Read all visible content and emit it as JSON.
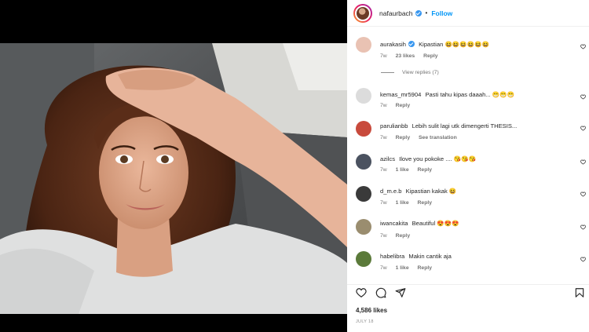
{
  "post": {
    "username": "nafaurbach",
    "dot": "•",
    "follow_label": "Follow",
    "likes": "4,586 likes",
    "date": "JULY 18"
  },
  "comments": [
    {
      "user": "aurakasih",
      "text": "Kipastian",
      "emoji": "😆😆😆😆😆😆",
      "verified": true,
      "time": "7w",
      "likes": "23 likes",
      "reply": "Reply",
      "avatar_color": "#e9c2b3"
    },
    {
      "user": "kemas_mr5904",
      "text": "Pasti tahu kipas daaah...",
      "emoji": "😁😁😁",
      "time": "7w",
      "reply": "Reply",
      "avatar_color": "#dcdcdc"
    },
    {
      "user": "parulianbb",
      "text": "Lebih sulit lagi utk dimengerti THESIS...",
      "emoji": "",
      "time": "7w",
      "reply": "Reply",
      "translation": "See translation",
      "avatar_color": "#c84a3c"
    },
    {
      "user": "azilcs",
      "text": "Ilove you pokoke ....",
      "emoji": "😘😘😘",
      "time": "7w",
      "likes": "1 like",
      "reply": "Reply",
      "avatar_color": "#4b5260"
    },
    {
      "user": "d_m.e.b",
      "text": "Kipastian kakak",
      "emoji": "😆",
      "time": "7w",
      "likes": "1 like",
      "reply": "Reply",
      "avatar_color": "#3a3a3a"
    },
    {
      "user": "iwancakita",
      "text": "Beautiful",
      "emoji": "😍😍😍",
      "time": "7w",
      "reply": "Reply",
      "avatar_color": "#9a8d6f"
    },
    {
      "user": "habelibra",
      "text": "Makin cantik aja",
      "emoji": "",
      "time": "7w",
      "likes": "1 like",
      "reply": "Reply",
      "avatar_color": "#5b7a3a"
    }
  ],
  "view_replies": "View replies (7)",
  "icons": {
    "like": "heart-outline-icon",
    "comment": "comment-bubble-icon",
    "share": "paper-plane-icon",
    "save": "bookmark-icon"
  }
}
